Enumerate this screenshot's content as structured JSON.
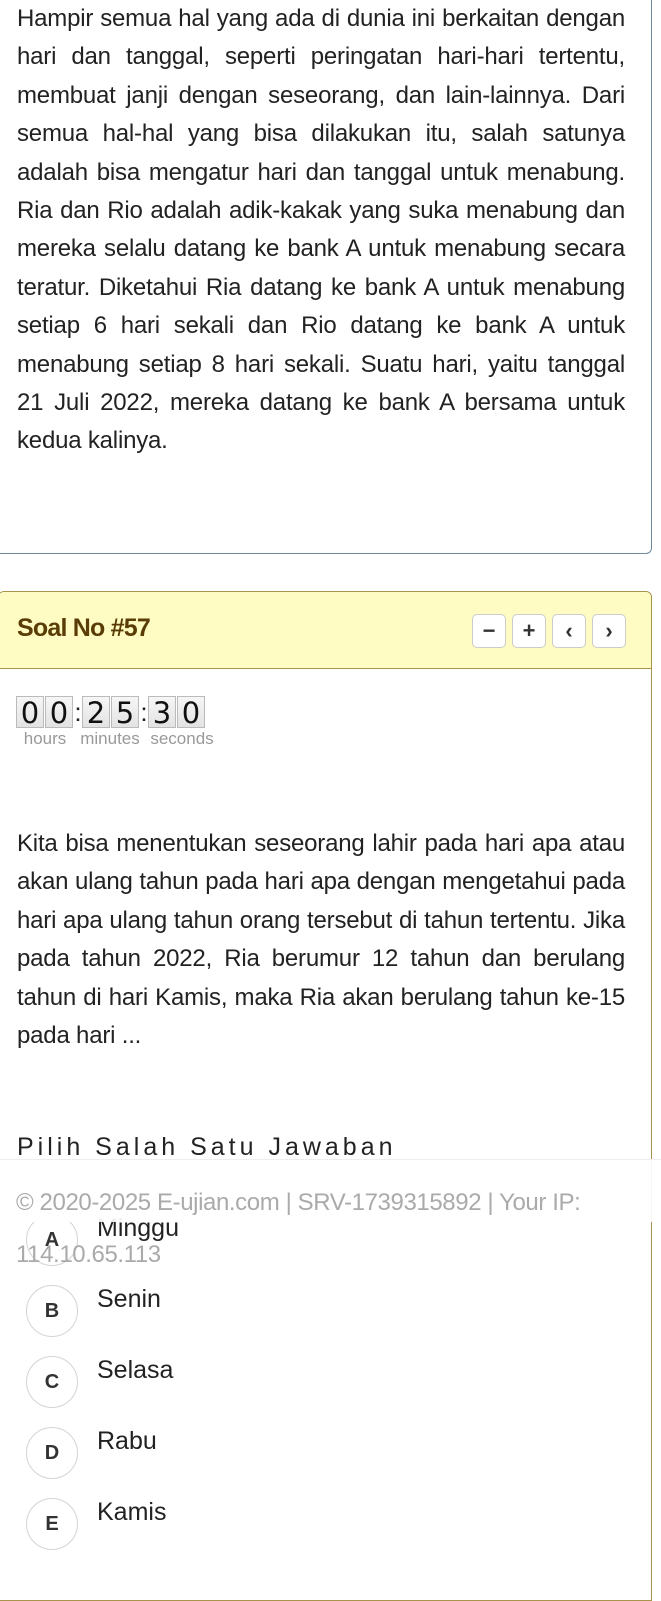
{
  "story": {
    "text": "Hampir semua hal yang ada di dunia ini berkaitan dengan hari dan tanggal, seperti peringatan hari-hari tertentu, membuat janji dengan seseorang, dan lain-lainnya. Dari semua hal-hal yang bisa dilakukan itu, salah satunya adalah bisa mengatur hari dan tanggal untuk menabung. Ria dan Rio adalah adik-kakak yang suka menabung dan mereka selalu datang ke bank A untuk menabung secara teratur. Diketahui Ria datang ke bank A untuk menabung setiap 6 hari sekali dan Rio datang ke bank A untuk menabung setiap 8 hari sekali. Suatu hari, yaitu tanggal 21 Juli 2022, mereka datang ke bank A bersama untuk kedua kalinya."
  },
  "question": {
    "title": "Soal No #57",
    "nav": {
      "minus": "−",
      "plus": "+",
      "prev": "‹",
      "next": "›"
    },
    "timer": {
      "hours": [
        "0",
        "0"
      ],
      "minutes": [
        "2",
        "5"
      ],
      "seconds": [
        "3",
        "0"
      ],
      "separator": ":",
      "labels": {
        "hours": "hours",
        "minutes": "minutes",
        "seconds": "seconds"
      }
    },
    "text": "Kita bisa menentukan seseorang lahir pada hari apa atau akan ulang tahun pada hari apa dengan mengetahui pada hari apa ulang tahun orang tersebut di tahun tertentu. Jika pada tahun 2022, Ria berumur 12 tahun dan berulang tahun di hari Kamis, maka Ria akan berulang tahun ke-15 pada hari ...",
    "choose_label": "Pilih Salah Satu Jawaban",
    "options": [
      {
        "letter": "A",
        "label": "Minggu"
      },
      {
        "letter": "B",
        "label": "Senin"
      },
      {
        "letter": "C",
        "label": "Selasa"
      },
      {
        "letter": "D",
        "label": "Rabu"
      },
      {
        "letter": "E",
        "label": "Kamis"
      }
    ]
  },
  "footer": {
    "text": "© 2020-2025 E-ujian.com | SRV-1739315892 | Your IP: 114.10.65.113"
  }
}
